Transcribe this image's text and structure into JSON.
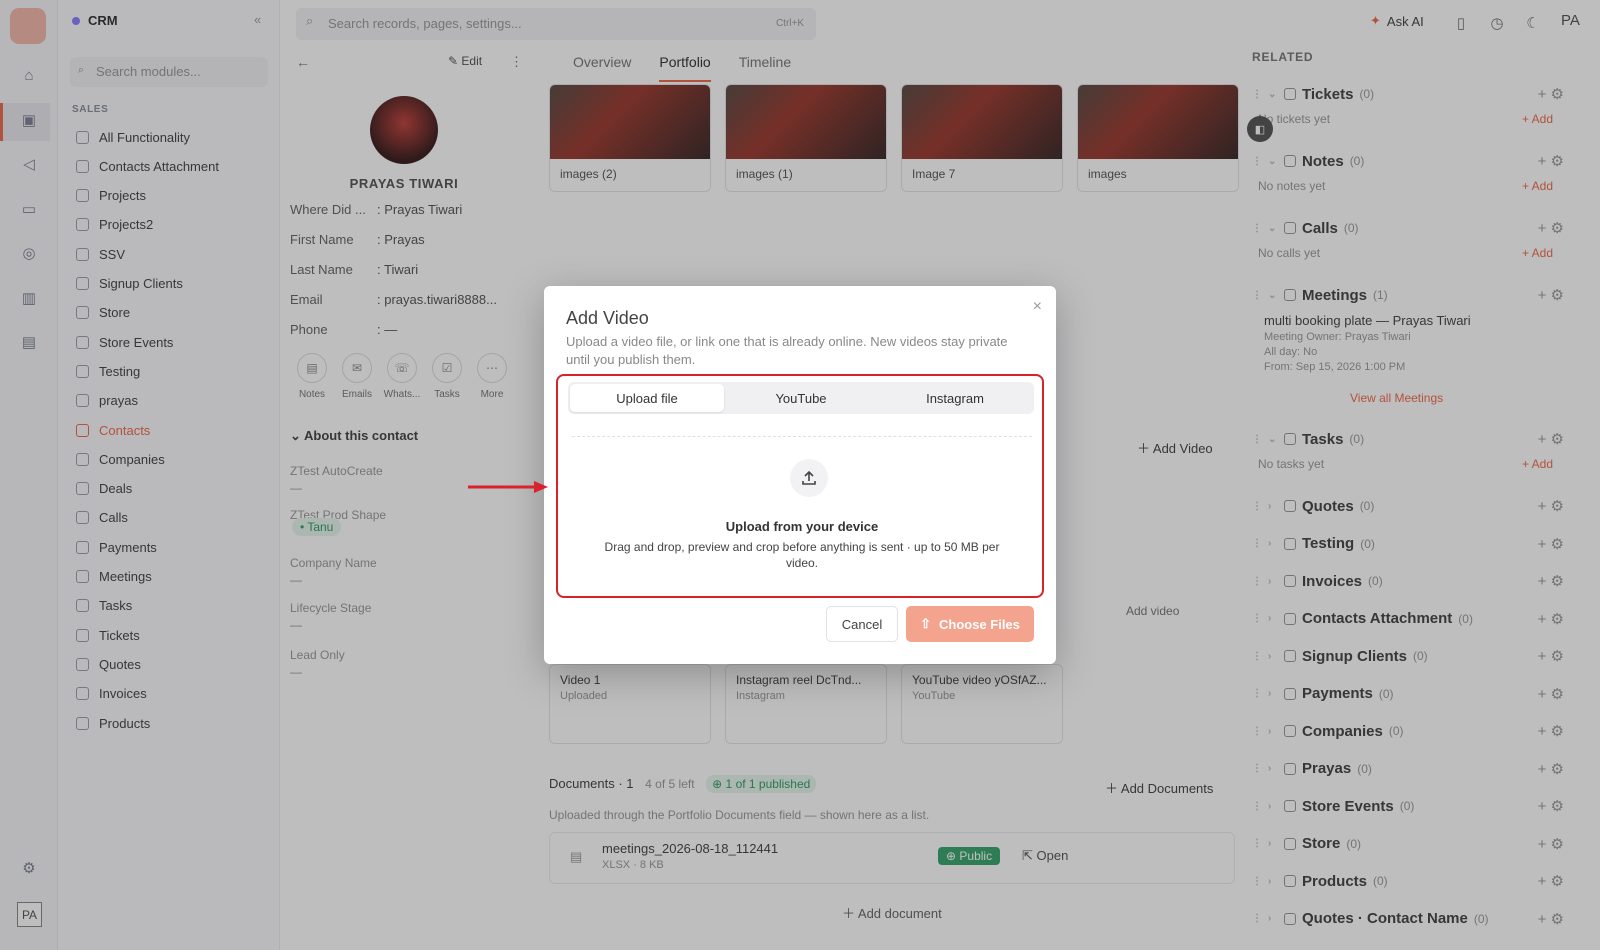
{
  "app": {
    "name": "CRM",
    "logo": "CRM",
    "collapse_icon": "«"
  },
  "search": {
    "placeholder": "Search records, pages, settings...",
    "shortcut": "Ctrl+K"
  },
  "header": {
    "ask_ai": "Ask AI",
    "user": "PA"
  },
  "rail": {
    "user": "PA"
  },
  "modules": {
    "search_placeholder": "Search modules...",
    "section": "SALES",
    "items": [
      "All Functionality",
      "Contacts Attachment",
      "Projects",
      "Projects2",
      "SSV",
      "Signup Clients",
      "Store",
      "Store Events",
      "Testing",
      "prayas",
      "Contacts",
      "Companies",
      "Deals",
      "Calls",
      "Payments",
      "Meetings",
      "Tasks",
      "Tickets",
      "Quotes",
      "Invoices",
      "Products"
    ],
    "active": "Contacts"
  },
  "contact": {
    "edit": "Edit",
    "name": "PRAYAS TIWARI",
    "fields": [
      {
        "k": "Where Did ...",
        "v": ": Prayas Tiwari"
      },
      {
        "k": "First Name",
        "v": ": Prayas"
      },
      {
        "k": "Last Name",
        "v": ": Tiwari"
      },
      {
        "k": "Email",
        "v": ": prayas.tiwari8888..."
      },
      {
        "k": "Phone",
        "v": ": —"
      }
    ],
    "actions": [
      "Notes",
      "Emails",
      "Whats...",
      "Tasks",
      "More"
    ],
    "about": "About this contact",
    "about_fields": [
      {
        "k": "ZTest AutoCreate",
        "v": "—"
      },
      {
        "k": "ZTest Prod Shape",
        "v": ""
      },
      {
        "k": "Company Name",
        "v": "—"
      },
      {
        "k": "Lifecycle Stage",
        "v": "—"
      },
      {
        "k": "Lead Only",
        "v": "—"
      }
    ],
    "chip": "• Tanu"
  },
  "main": {
    "tabs": [
      "Overview",
      "Portfolio",
      "Timeline"
    ],
    "active_tab": "Portfolio",
    "images": [
      "images (2)",
      "images (1)",
      "Image 7",
      "images"
    ],
    "add_video": "Add Video",
    "add_video_small": "Add video",
    "videos": [
      {
        "t": "Video 1",
        "s": "Uploaded"
      },
      {
        "t": "Instagram reel DcTnd...",
        "s": "Instagram"
      },
      {
        "t": "YouTube video yOSfAZ...",
        "s": "YouTube"
      }
    ],
    "docs_title": "Documents · 1",
    "docs_left": "4 of 5 left",
    "docs_published": "⊕ 1 of 1 published",
    "add_documents": "Add Documents",
    "docs_desc": "Uploaded through the Portfolio Documents field — shown here as a list.",
    "doc_name": "meetings_2026-08-18_112441",
    "doc_meta": "XLSX · 8 KB",
    "doc_badge": "⊕ Public",
    "doc_open": "Open",
    "add_document": "Add document"
  },
  "related": {
    "title": "RELATED",
    "sections": [
      {
        "name": "Tickets",
        "count": "(0)",
        "empty": "No tickets yet"
      },
      {
        "name": "Notes",
        "count": "(0)",
        "empty": "No notes yet"
      },
      {
        "name": "Calls",
        "count": "(0)",
        "empty": "No calls yet"
      },
      {
        "name": "Meetings",
        "count": "(1)"
      },
      {
        "name": "Tasks",
        "count": "(0)",
        "empty": "No tasks yet"
      },
      {
        "name": "Quotes",
        "count": "(0)"
      },
      {
        "name": "Testing",
        "count": "(0)"
      },
      {
        "name": "Invoices",
        "count": "(0)"
      },
      {
        "name": "Contacts Attachment",
        "count": "(0)"
      },
      {
        "name": "Signup Clients",
        "count": "(0)"
      },
      {
        "name": "Payments",
        "count": "(0)"
      },
      {
        "name": "Companies",
        "count": "(0)"
      },
      {
        "name": "Prayas",
        "count": "(0)"
      },
      {
        "name": "Store Events",
        "count": "(0)"
      },
      {
        "name": "Store",
        "count": "(0)"
      },
      {
        "name": "Products",
        "count": "(0)"
      },
      {
        "name": "Quotes · Contact Name",
        "count": "(0)"
      }
    ],
    "add": "+ Add",
    "meeting": {
      "title": "multi booking plate — Prayas Tiwari",
      "owner": "Meeting Owner: Prayas Tiwari",
      "allday": "All day: No",
      "from": "From: Sep 15, 2026 1:00 PM",
      "view_all": "View all Meetings"
    }
  },
  "modal": {
    "title": "Add Video",
    "subtitle": "Upload a video file, or link one that is already online. New videos stay private until you publish them.",
    "tabs": [
      "Upload file",
      "YouTube",
      "Instagram"
    ],
    "drop_title": "Upload from your device",
    "drop_desc": "Drag and drop, preview and crop before anything is sent · up to 50 MB per video.",
    "cancel": "Cancel",
    "choose": "Choose Files"
  },
  "colors": {
    "accent": "#ef6a4c",
    "highlight": "#d8232a"
  }
}
